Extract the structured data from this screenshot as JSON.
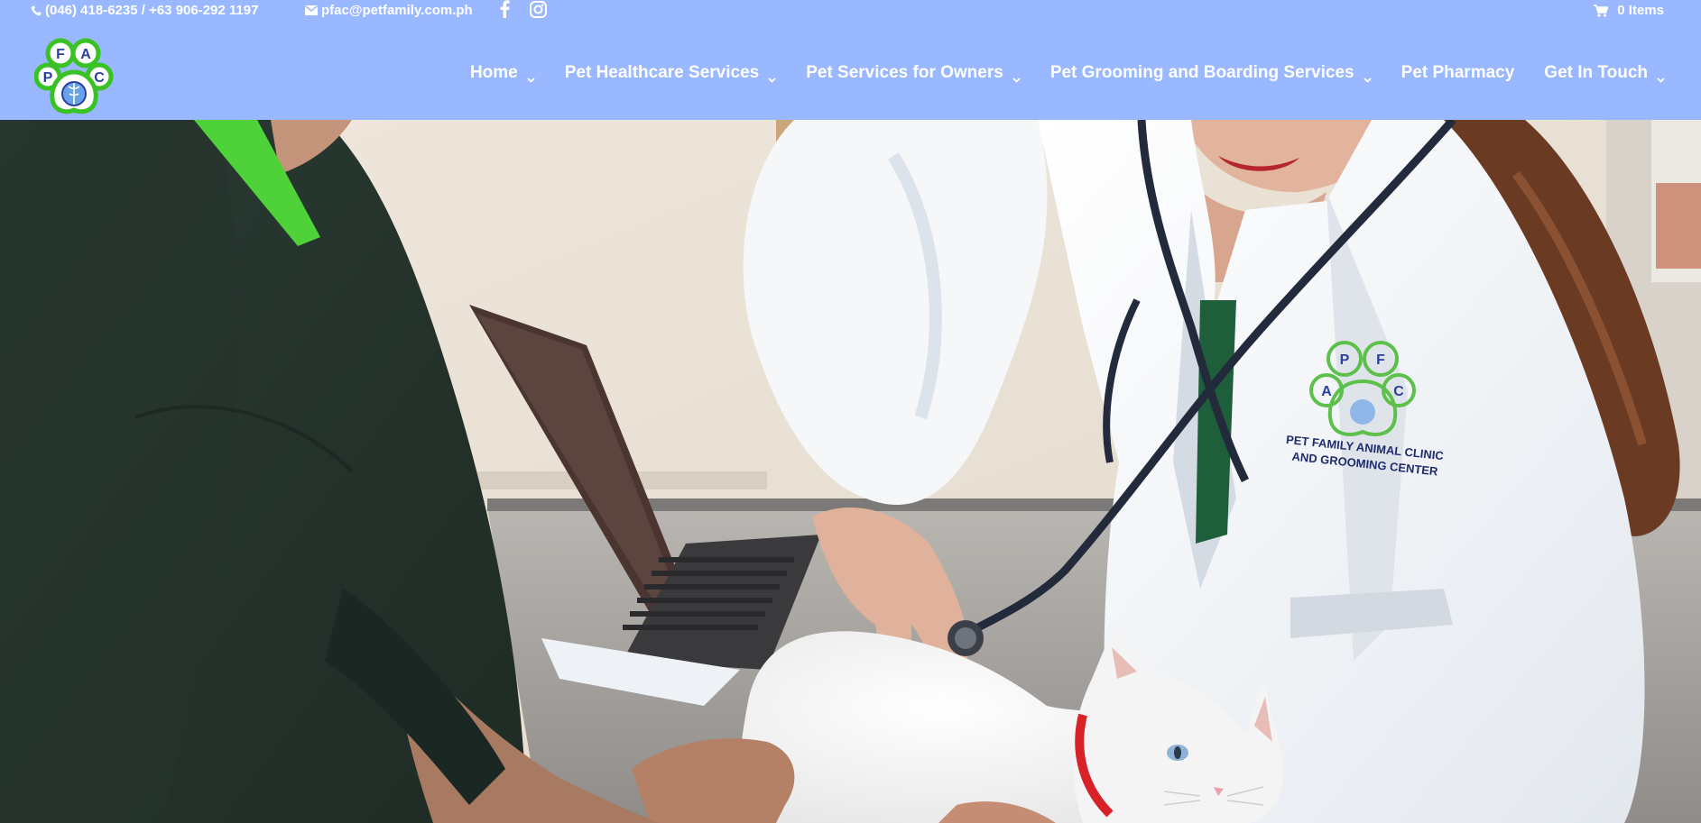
{
  "topbar": {
    "phone": "(046) 418-6235 / +63 906-292 1197",
    "email": "pfac@petfamily.com.ph",
    "cart": "0 Items",
    "icons": {
      "phone": "phone-icon",
      "email": "envelope-icon",
      "facebook": "facebook-icon",
      "instagram": "instagram-icon",
      "cart": "cart-icon"
    }
  },
  "logo": {
    "letters": [
      "F",
      "A",
      "P",
      "C"
    ]
  },
  "nav": {
    "items": [
      {
        "label": "Home",
        "has_dropdown": true
      },
      {
        "label": "Pet Healthcare Services",
        "has_dropdown": true
      },
      {
        "label": "Pet Services for Owners",
        "has_dropdown": true
      },
      {
        "label": "Pet Grooming and Boarding Services",
        "has_dropdown": true
      },
      {
        "label": "Pet Pharmacy",
        "has_dropdown": false
      },
      {
        "label": "Get In Touch",
        "has_dropdown": true
      }
    ]
  },
  "hero": {
    "coat_badge_line1": "PET FAMILY ANIMAL CLINIC",
    "coat_badge_line2": "AND GROOMING CENTER",
    "coat_logo_letters": [
      "P",
      "F",
      "A",
      "C"
    ]
  },
  "colors": {
    "header_bg": "#9ab8ff",
    "logo_green": "#39c224",
    "logo_blue": "#2a3fa0",
    "text_white": "#ffffff"
  }
}
